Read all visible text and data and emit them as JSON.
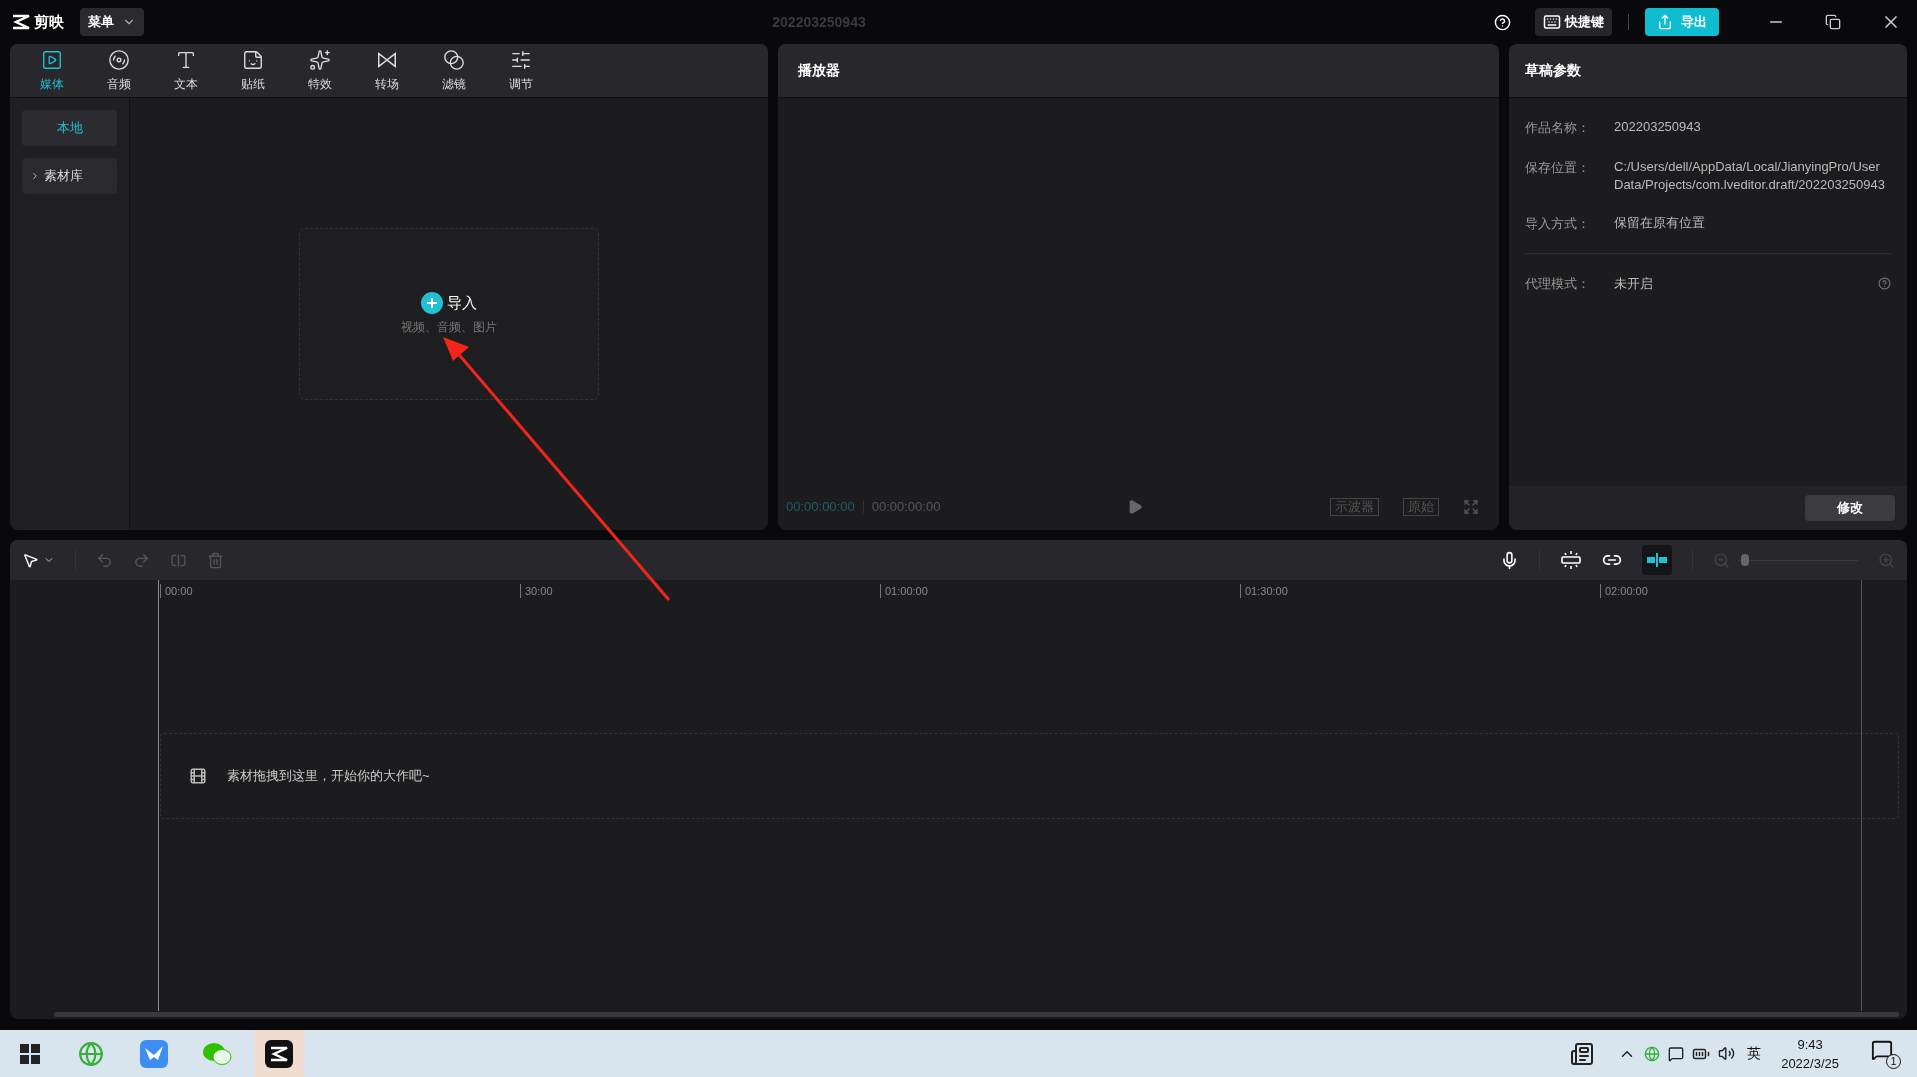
{
  "app": {
    "name": "剪映",
    "menu": "菜单",
    "title": "202203250943",
    "shortcut": "快捷键",
    "export": "导出"
  },
  "media_tabs": [
    {
      "label": "媒体",
      "kind": "media",
      "selected": true
    },
    {
      "label": "音频",
      "kind": "audio",
      "selected": false
    },
    {
      "label": "文本",
      "kind": "text",
      "selected": false
    },
    {
      "label": "贴纸",
      "kind": "sticker",
      "selected": false
    },
    {
      "label": "特效",
      "kind": "effects",
      "selected": false
    },
    {
      "label": "转场",
      "kind": "transition",
      "selected": false
    },
    {
      "label": "滤镜",
      "kind": "filter",
      "selected": false
    },
    {
      "label": "调节",
      "kind": "adjust",
      "selected": false
    }
  ],
  "sidebar": [
    {
      "label": "本地",
      "kind": "item",
      "selected": true
    },
    {
      "label": "素材库",
      "kind": "folder",
      "selected": false
    }
  ],
  "import": {
    "label": "导入",
    "hint": "视频、音频、图片"
  },
  "player": {
    "title": "播放器",
    "current_time": "00:00:00:00",
    "total_time": "00:00:00:00",
    "buttons": [
      "示波器",
      "原始"
    ]
  },
  "draft": {
    "title": "草稿参数",
    "fields": [
      {
        "label": "作品名称：",
        "value": "202203250943"
      },
      {
        "label": "保存位置：",
        "value": "C:/Users/dell/AppData/Local/JianyingPro/User Data/Projects/com.lveditor.draft/202203250943"
      },
      {
        "label": "导入方式：",
        "value": "保留在原有位置"
      }
    ],
    "proxy": {
      "label": "代理模式：",
      "value": "未开启"
    },
    "edit_button": "修改"
  },
  "timeline": {
    "ticks": [
      "00:00",
      "30:00",
      "01:00:00",
      "01:30:00",
      "02:00:00"
    ],
    "hint": "素材拖拽到这里，开始你的大作吧~",
    "snap_on": true,
    "zoom_slider": {
      "level": 0.03
    }
  },
  "taskbar": {
    "ime": "英",
    "time": "9:43",
    "date": "2022/3/25",
    "notification_count": "1"
  }
}
